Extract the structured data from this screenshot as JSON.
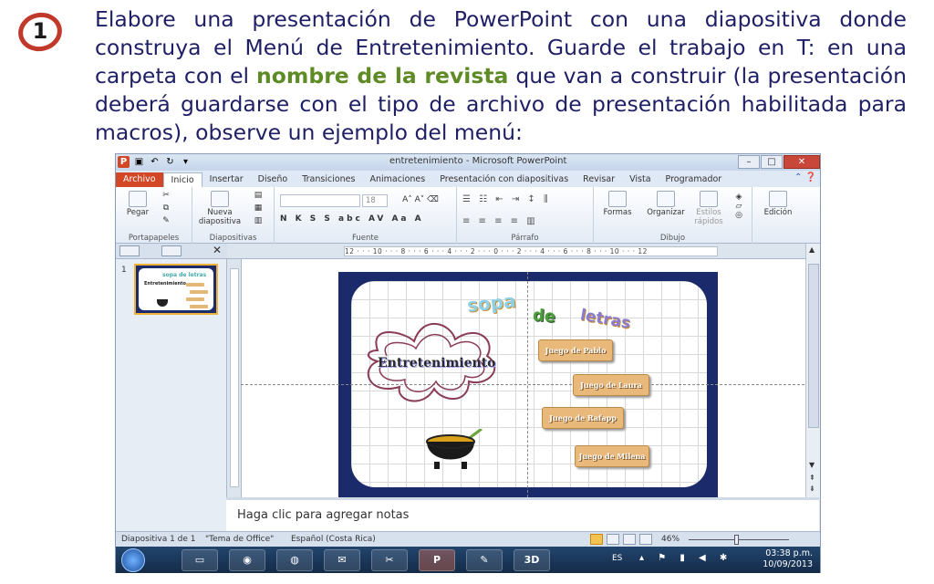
{
  "instruction": {
    "number": "1",
    "text_before": "Elabore una presentación de PowerPoint con una diapositiva donde construya el Menú de Entretenimiento. Guarde el trabajo en T: en una carpeta con el ",
    "highlight": "nombre de la revista",
    "text_after": " que van a construir (la presentación deberá guardarse con el tipo de archivo de presentación habilitada para macros), observe un ejemplo del menú:"
  },
  "window": {
    "title": "entretenimiento - Microsoft PowerPoint",
    "tabs": [
      "Archivo",
      "Inicio",
      "Insertar",
      "Diseño",
      "Transiciones",
      "Animaciones",
      "Presentación con diapositivas",
      "Revisar",
      "Vista",
      "Programador"
    ],
    "active_tab": "Inicio"
  },
  "ribbon": {
    "paste_label": "Pegar",
    "clipboard_group": "Portapapeles",
    "new_slide_label": "Nueva diapositiva",
    "slides_group": "Diapositivas",
    "font_size": "18",
    "font_group": "Fuente",
    "paragraph_group": "Párrafo",
    "shapes_label": "Formas",
    "arrange_label": "Organizar",
    "quick_styles_label": "Estilos rápidos",
    "drawing_group": "Dibujo",
    "editing_label": "Edición"
  },
  "panel": {
    "slide_number": "1"
  },
  "ruler": {
    "scale": "12 · · · 10 · · · 8 · · · 6 · · · 4 · · · 2 · · · 0 · · · 2 · · · 4 · · · 6 · · · 8 · · · 10 · · · 12"
  },
  "slide": {
    "title_sopa": "sopa",
    "title_de": "de",
    "title_letras": "letras",
    "entertainment": "Entretenimiento",
    "buttons": [
      "Juego de Pablo",
      "Juego de Laura",
      "Juego de Rafapp",
      "Juego de Milena"
    ]
  },
  "notes": {
    "placeholder": "Haga clic para agregar notas"
  },
  "statusbar": {
    "slide_info": "Diapositiva 1 de 1",
    "theme": "\"Tema de Office\"",
    "language": "Español (Costa Rica)",
    "zoom": "46%"
  },
  "taskbar": {
    "lang": "ES",
    "time": "03:38 p.m.",
    "date": "10/09/2013",
    "apps": [
      "explorer",
      "firefox",
      "chrome",
      "outlook",
      "snipping",
      "powerpoint",
      "paint",
      "3d"
    ]
  },
  "colors": {
    "accent_file_tab": "#d24726",
    "slide_border": "#1b2a6b",
    "highlight_text": "#5e8b25",
    "instruction_text": "#1f1f66",
    "badge_ring": "#c0392b"
  }
}
